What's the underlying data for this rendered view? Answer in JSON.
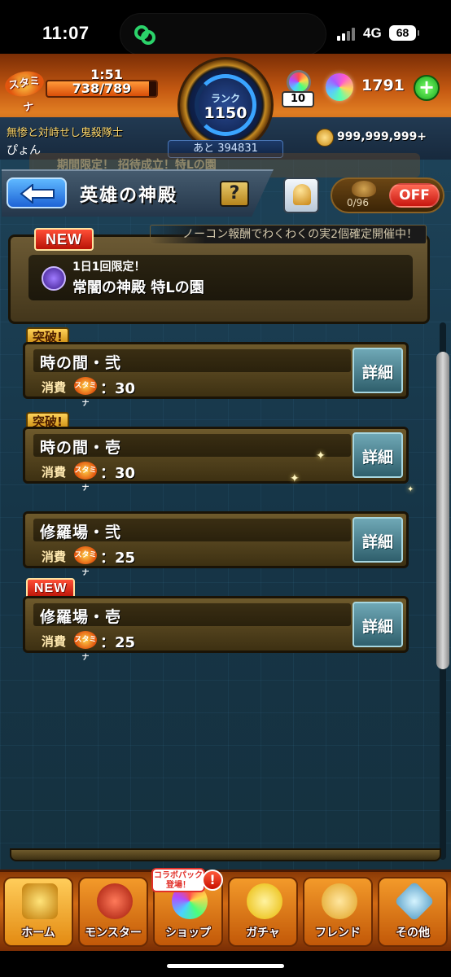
{
  "status_bar": {
    "time": "11:07",
    "network": "4G",
    "battery": "68"
  },
  "hud": {
    "stamina_label": "スタミナ",
    "stamina_timer": "1:51",
    "stamina_value": "738/789",
    "stamina_fraction": 0.935,
    "rank_label": "ランク",
    "rank_value": "1150",
    "rank_next": "あと 394831",
    "potion_count": "10",
    "orb_count": "1791",
    "plus_label": "+",
    "title": "無惨と対峙せし鬼殺隊士",
    "user_name": "ぴょん",
    "coin_count": "999,999,999+"
  },
  "header": {
    "ghost_banner": "期間限定！ 招待成立！特Lの園",
    "title": "英雄の神殿",
    "help_label": "?",
    "toggle_count": "0/96",
    "toggle_label": "OFF"
  },
  "event_banner": "ノーコン報酬でわくわくの実2個確定開催中！",
  "featured": {
    "badge": "NEW",
    "subtitle": "1日1回限定！",
    "title": "常闇の神殿 特Lの園"
  },
  "quests": [
    {
      "tag": "突破!",
      "name": "時の間・弐",
      "cost_label": "消費",
      "cost_icon": "スタミナ",
      "cost": "：30",
      "detail": "詳細"
    },
    {
      "tag": "突破!",
      "name": "時の間・壱",
      "cost_label": "消費",
      "cost_icon": "スタミナ",
      "cost": "：30",
      "detail": "詳細"
    },
    {
      "tag": "",
      "name": "修羅場・弐",
      "cost_label": "消費",
      "cost_icon": "スタミナ",
      "cost": "：25",
      "detail": "詳細"
    },
    {
      "tag": "NEW",
      "name": "修羅場・壱",
      "cost_label": "消費",
      "cost_icon": "スタミナ",
      "cost": "：25",
      "detail": "詳細"
    }
  ],
  "nav": {
    "home": "ホーム",
    "monster": "モンスター",
    "shop": "ショップ",
    "gacha": "ガチャ",
    "friend": "フレンド",
    "other": "その他",
    "collab_badge": "コラボパック登場！",
    "alert": "!"
  },
  "colors": {
    "accent_orange": "#d16a14",
    "panel_gold": "#6e5a2c",
    "bg_teal": "#163547",
    "new_red": "#c81000"
  }
}
